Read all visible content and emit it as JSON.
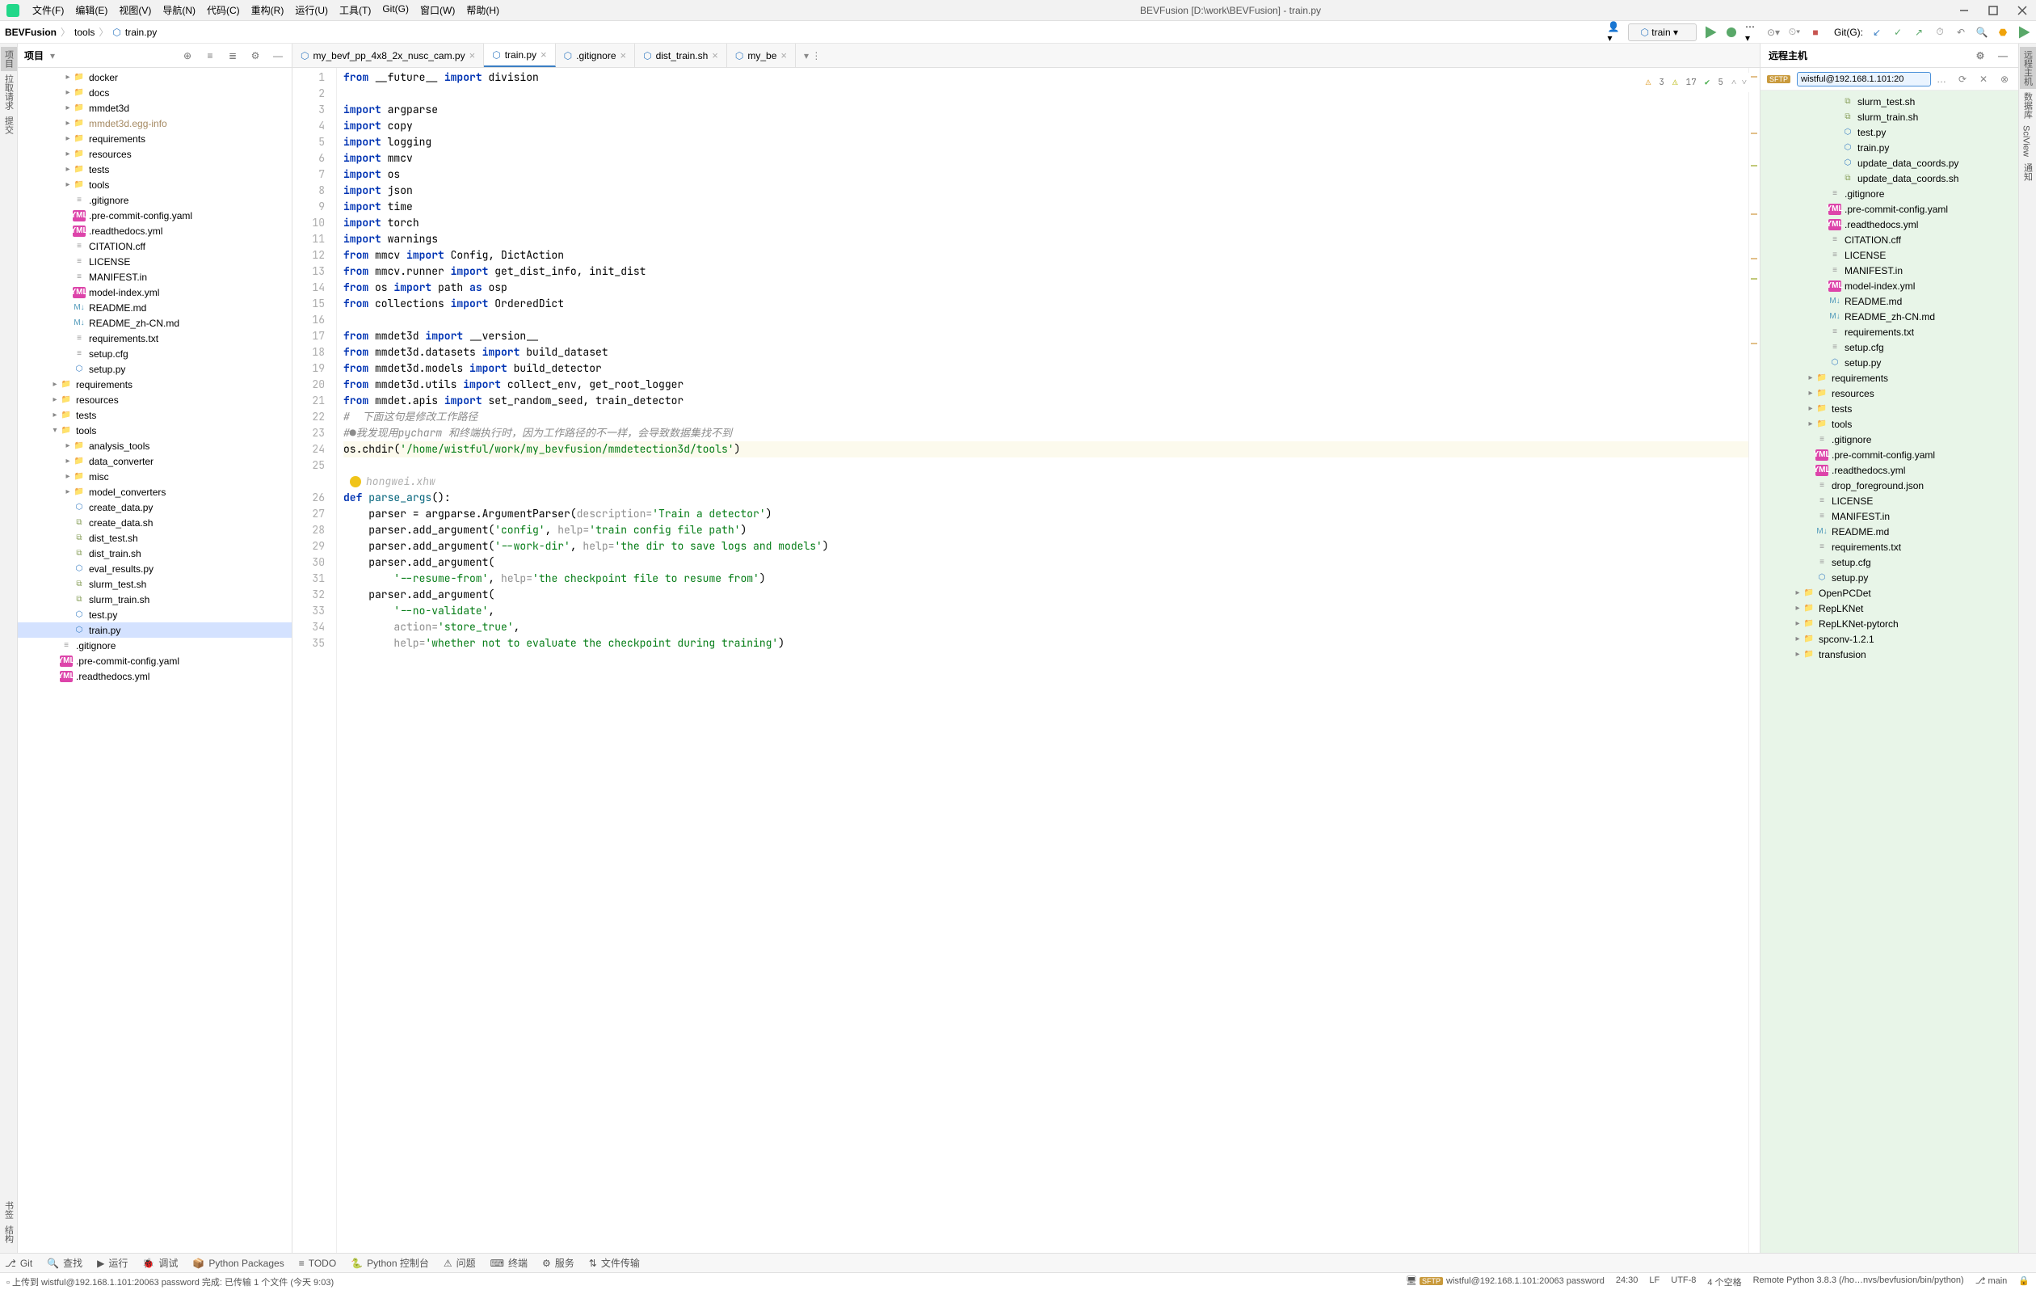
{
  "menu": [
    "文件(F)",
    "编辑(E)",
    "视图(V)",
    "导航(N)",
    "代码(C)",
    "重构(R)",
    "运行(U)",
    "工具(T)",
    "Git(G)",
    "窗口(W)",
    "帮助(H)"
  ],
  "title": "BEVFusion [D:\\work\\BEVFusion] - train.py",
  "breadcrumb": {
    "root": "BEVFusion",
    "folder": "tools",
    "file": "train.py"
  },
  "runConfig": "train",
  "gitLabel": "Git(G):",
  "projectPanel": {
    "title": "项目"
  },
  "projectTree": [
    {
      "d": 3,
      "c": "▸",
      "i": "fold",
      "t": "docker"
    },
    {
      "d": 3,
      "c": "▸",
      "i": "fold",
      "t": "docs"
    },
    {
      "d": 3,
      "c": "▸",
      "i": "fold",
      "t": "mmdet3d"
    },
    {
      "d": 3,
      "c": "▸",
      "i": "fold",
      "t": "mmdet3d.egg-info",
      "brown": true
    },
    {
      "d": 3,
      "c": "▸",
      "i": "fold",
      "t": "requirements"
    },
    {
      "d": 3,
      "c": "▸",
      "i": "fold",
      "t": "resources"
    },
    {
      "d": 3,
      "c": "▸",
      "i": "fold",
      "t": "tests"
    },
    {
      "d": 3,
      "c": "▸",
      "i": "fold",
      "t": "tools"
    },
    {
      "d": 3,
      "c": "",
      "i": "txt",
      "t": ".gitignore"
    },
    {
      "d": 3,
      "c": "",
      "i": "yml",
      "t": ".pre-commit-config.yaml"
    },
    {
      "d": 3,
      "c": "",
      "i": "yml",
      "t": ".readthedocs.yml"
    },
    {
      "d": 3,
      "c": "",
      "i": "txt",
      "t": "CITATION.cff"
    },
    {
      "d": 3,
      "c": "",
      "i": "txt",
      "t": "LICENSE"
    },
    {
      "d": 3,
      "c": "",
      "i": "txt",
      "t": "MANIFEST.in"
    },
    {
      "d": 3,
      "c": "",
      "i": "yml",
      "t": "model-index.yml"
    },
    {
      "d": 3,
      "c": "",
      "i": "md",
      "t": "README.md"
    },
    {
      "d": 3,
      "c": "",
      "i": "md",
      "t": "README_zh-CN.md"
    },
    {
      "d": 3,
      "c": "",
      "i": "txt",
      "t": "requirements.txt"
    },
    {
      "d": 3,
      "c": "",
      "i": "txt",
      "t": "setup.cfg"
    },
    {
      "d": 3,
      "c": "",
      "i": "py",
      "t": "setup.py"
    },
    {
      "d": 2,
      "c": "▸",
      "i": "fold",
      "t": "requirements"
    },
    {
      "d": 2,
      "c": "▸",
      "i": "fold",
      "t": "resources"
    },
    {
      "d": 2,
      "c": "▸",
      "i": "fold",
      "t": "tests"
    },
    {
      "d": 2,
      "c": "▾",
      "i": "fold",
      "t": "tools"
    },
    {
      "d": 3,
      "c": "▸",
      "i": "fold",
      "t": "analysis_tools"
    },
    {
      "d": 3,
      "c": "▸",
      "i": "fold",
      "t": "data_converter"
    },
    {
      "d": 3,
      "c": "▸",
      "i": "fold",
      "t": "misc"
    },
    {
      "d": 3,
      "c": "▸",
      "i": "fold",
      "t": "model_converters"
    },
    {
      "d": 3,
      "c": "",
      "i": "py",
      "t": "create_data.py"
    },
    {
      "d": 3,
      "c": "",
      "i": "sh",
      "t": "create_data.sh"
    },
    {
      "d": 3,
      "c": "",
      "i": "sh",
      "t": "dist_test.sh"
    },
    {
      "d": 3,
      "c": "",
      "i": "sh",
      "t": "dist_train.sh"
    },
    {
      "d": 3,
      "c": "",
      "i": "py",
      "t": "eval_results.py"
    },
    {
      "d": 3,
      "c": "",
      "i": "sh",
      "t": "slurm_test.sh"
    },
    {
      "d": 3,
      "c": "",
      "i": "sh",
      "t": "slurm_train.sh"
    },
    {
      "d": 3,
      "c": "",
      "i": "py",
      "t": "test.py"
    },
    {
      "d": 3,
      "c": "",
      "i": "py",
      "t": "train.py",
      "sel": true
    },
    {
      "d": 2,
      "c": "",
      "i": "txt",
      "t": ".gitignore"
    },
    {
      "d": 2,
      "c": "",
      "i": "yml",
      "t": ".pre-commit-config.yaml"
    },
    {
      "d": 2,
      "c": "",
      "i": "yml",
      "t": ".readthedocs.yml"
    }
  ],
  "tabs": [
    {
      "label": "my_bevf_pp_4x8_2x_nusc_cam.py",
      "icon": "py"
    },
    {
      "label": "train.py",
      "icon": "py",
      "active": true
    },
    {
      "label": ".gitignore",
      "icon": "txt"
    },
    {
      "label": "dist_train.sh",
      "icon": "sh"
    },
    {
      "label": "my_be",
      "icon": "py"
    }
  ],
  "inspections": {
    "warn": 3,
    "weak": 17,
    "ok": 5
  },
  "author": "hongwei.xhw",
  "code": [
    {
      "n": 1,
      "html": "<span class='kw'>from</span> __future__ <span class='kw'>import</span> division"
    },
    {
      "n": 2,
      "html": ""
    },
    {
      "n": 3,
      "html": "<span class='kw'>import</span> argparse"
    },
    {
      "n": 4,
      "html": "<span class='kw'>import</span> copy"
    },
    {
      "n": 5,
      "html": "<span class='kw'>import</span> logging"
    },
    {
      "n": 6,
      "html": "<span class='kw'>import</span> mmcv"
    },
    {
      "n": 7,
      "html": "<span class='kw'>import</span> os"
    },
    {
      "n": 8,
      "html": "<span class='kw'>import</span> json"
    },
    {
      "n": 9,
      "html": "<span class='kw'>import</span> time"
    },
    {
      "n": 10,
      "html": "<span class='kw'>import</span> torch"
    },
    {
      "n": 11,
      "html": "<span class='kw'>import</span> warnings"
    },
    {
      "n": 12,
      "html": "<span class='kw'>from</span> mmcv <span class='kw'>import</span> Config, DictAction"
    },
    {
      "n": 13,
      "html": "<span class='kw'>from</span> mmcv.runner <span class='kw'>import</span> get_dist_info, init_dist"
    },
    {
      "n": 14,
      "html": "<span class='kw'>from</span> os <span class='kw'>import</span> path <span class='kw'>as</span> osp"
    },
    {
      "n": 15,
      "html": "<span class='kw'>from</span> collections <span class='kw'>import</span> OrderedDict"
    },
    {
      "n": 16,
      "html": ""
    },
    {
      "n": 17,
      "html": "<span class='kw'>from</span> mmdet3d <span class='kw'>import</span> __version__"
    },
    {
      "n": 18,
      "html": "<span class='kw'>from</span> mmdet3d.datasets <span class='kw'>import</span> build_dataset"
    },
    {
      "n": 19,
      "html": "<span class='kw'>from</span> mmdet3d.models <span class='kw'>import</span> build_detector"
    },
    {
      "n": 20,
      "html": "<span class='kw'>from</span> mmdet3d.utils <span class='kw'>import</span> collect_env, get_root_logger"
    },
    {
      "n": 21,
      "html": "<span class='kw'>from</span> mmdet.apis <span class='kw'>import</span> set_random_seed, train_detector"
    },
    {
      "n": 22,
      "html": "<span class='cmt'>#  下面这句是修改工作路径</span>"
    },
    {
      "n": 23,
      "html": "<span class='cmt'>#●我发现用pycharm 和终端执行时，因为工作路径的不一样，会导致数据集找不到</span>"
    },
    {
      "n": 24,
      "hl": true,
      "html": "os.chdir(<span class='str'>'/home/wistful/work/my_bevfusion/mmdetection3d/tools'</span>)"
    },
    {
      "n": 25,
      "html": ""
    }
  ],
  "code2": [
    {
      "n": 26,
      "html": "<span class='kw'>def</span> <span class='fn'>parse_args</span>():"
    },
    {
      "n": 27,
      "html": "    parser = argparse.ArgumentParser(<span class='grey'>description=</span><span class='str'>'Train a detector'</span>)"
    },
    {
      "n": 28,
      "html": "    parser.add_argument(<span class='str'>'config'</span>, <span class='grey'>help=</span><span class='str'>'train config file path'</span>)"
    },
    {
      "n": 29,
      "html": "    parser.add_argument(<span class='str'>'--work-dir'</span>, <span class='grey'>help=</span><span class='str'>'the dir to save logs and models'</span>)"
    },
    {
      "n": 30,
      "html": "    parser.add_argument("
    },
    {
      "n": 31,
      "html": "        <span class='str'>'--resume-from'</span>, <span class='grey'>help=</span><span class='str'>'the checkpoint file to resume from'</span>)"
    },
    {
      "n": 32,
      "html": "    parser.add_argument("
    },
    {
      "n": 33,
      "html": "        <span class='str'>'--no-validate'</span>,"
    },
    {
      "n": 34,
      "html": "        <span class='grey'>action=</span><span class='str'>'store_true'</span>,"
    },
    {
      "n": 35,
      "html": "        <span class='grey'>help=</span><span class='str'>'whether not to evaluate the checkpoint during training'</span>)"
    }
  ],
  "remote": {
    "title": "远程主机",
    "addr": "wistful@192.168.1.101:20",
    "tree": [
      {
        "d": 5,
        "i": "sh",
        "t": "slurm_test.sh"
      },
      {
        "d": 5,
        "i": "sh",
        "t": "slurm_train.sh"
      },
      {
        "d": 5,
        "i": "py",
        "t": "test.py"
      },
      {
        "d": 5,
        "i": "py",
        "t": "train.py"
      },
      {
        "d": 5,
        "i": "py",
        "t": "update_data_coords.py"
      },
      {
        "d": 5,
        "i": "sh",
        "t": "update_data_coords.sh"
      },
      {
        "d": 4,
        "i": "txt",
        "t": ".gitignore"
      },
      {
        "d": 4,
        "i": "yml",
        "t": ".pre-commit-config.yaml"
      },
      {
        "d": 4,
        "i": "yml",
        "t": ".readthedocs.yml"
      },
      {
        "d": 4,
        "i": "txt",
        "t": "CITATION.cff"
      },
      {
        "d": 4,
        "i": "txt",
        "t": "LICENSE"
      },
      {
        "d": 4,
        "i": "txt",
        "t": "MANIFEST.in"
      },
      {
        "d": 4,
        "i": "yml",
        "t": "model-index.yml"
      },
      {
        "d": 4,
        "i": "md",
        "t": "README.md"
      },
      {
        "d": 4,
        "i": "md",
        "t": "README_zh-CN.md"
      },
      {
        "d": 4,
        "i": "txt",
        "t": "requirements.txt"
      },
      {
        "d": 4,
        "i": "txt",
        "t": "setup.cfg"
      },
      {
        "d": 4,
        "i": "py",
        "t": "setup.py"
      },
      {
        "d": 3,
        "c": "▸",
        "i": "fold",
        "t": "requirements"
      },
      {
        "d": 3,
        "c": "▸",
        "i": "fold",
        "t": "resources"
      },
      {
        "d": 3,
        "c": "▸",
        "i": "fold",
        "t": "tests"
      },
      {
        "d": 3,
        "c": "▸",
        "i": "fold",
        "t": "tools"
      },
      {
        "d": 3,
        "i": "txt",
        "t": ".gitignore"
      },
      {
        "d": 3,
        "i": "yml",
        "t": ".pre-commit-config.yaml"
      },
      {
        "d": 3,
        "i": "yml",
        "t": ".readthedocs.yml"
      },
      {
        "d": 3,
        "i": "txt",
        "t": "drop_foreground.json"
      },
      {
        "d": 3,
        "i": "txt",
        "t": "LICENSE"
      },
      {
        "d": 3,
        "i": "txt",
        "t": "MANIFEST.in"
      },
      {
        "d": 3,
        "i": "md",
        "t": "README.md"
      },
      {
        "d": 3,
        "i": "txt",
        "t": "requirements.txt"
      },
      {
        "d": 3,
        "i": "txt",
        "t": "setup.cfg"
      },
      {
        "d": 3,
        "i": "py",
        "t": "setup.py"
      },
      {
        "d": 2,
        "c": "▸",
        "i": "fold",
        "t": "OpenPCDet"
      },
      {
        "d": 2,
        "c": "▸",
        "i": "fold",
        "t": "RepLKNet"
      },
      {
        "d": 2,
        "c": "▸",
        "i": "fold",
        "t": "RepLKNet-pytorch"
      },
      {
        "d": 2,
        "c": "▸",
        "i": "fold",
        "t": "spconv-1.2.1"
      },
      {
        "d": 2,
        "c": "▸",
        "i": "fold",
        "t": "transfusion"
      }
    ]
  },
  "bottomTools": [
    "Git",
    "查找",
    "运行",
    "调试",
    "Python Packages",
    "TODO",
    "Python 控制台",
    "问题",
    "终端",
    "服务",
    "文件传输"
  ],
  "status": {
    "left": "上传到 wistful@192.168.1.101:20063 password 完成: 已传输 1 个文件 (今天 9:03)",
    "conn": "wistful@192.168.1.101:20063 password",
    "pos": "24:30",
    "sep": "LF",
    "enc": "UTF-8",
    "indent": "4 个空格",
    "interp": "Remote Python 3.8.3 (/ho…nvs/bevfusion/bin/python)",
    "branch": "main"
  },
  "leftSideTabs": [
    "项目",
    "拉取请求",
    "提交"
  ],
  "leftBottomTabs": [
    "书签",
    "结构"
  ],
  "rightSideTabs": [
    "远程主机",
    "数据库",
    "SciView",
    "通知"
  ]
}
